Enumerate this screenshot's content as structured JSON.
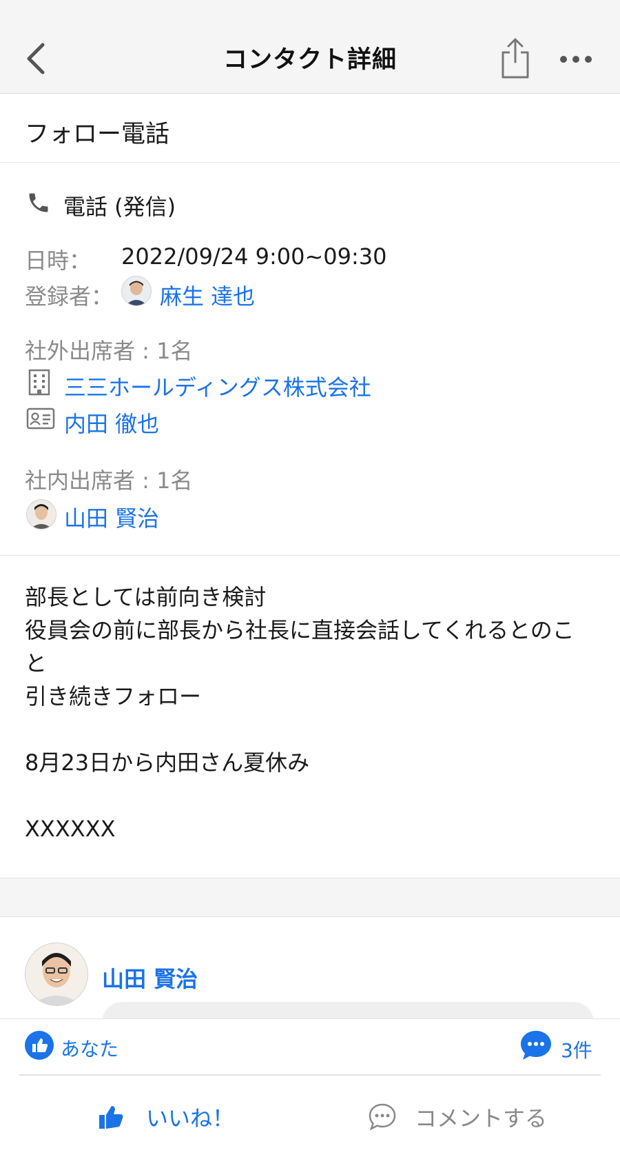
{
  "header": {
    "title": "コンタクト詳細"
  },
  "subject": "フォロー電話",
  "activity": {
    "type_label": "電話 (発信)",
    "datetime_label": "日時：",
    "datetime_value": "2022/09/24 9:00~09:30",
    "registrant_label": "登録者：",
    "registrant_name": "麻生 達也"
  },
  "external": {
    "heading": "社外出席者 : 1名",
    "company": "三三ホールディングス株式会社",
    "person": "内田 徹也"
  },
  "internal": {
    "heading": "社内出席者 : 1名",
    "person": "山田 賢治"
  },
  "notes": {
    "line1": "部長としては前向き検討",
    "line2": "役員会の前に部長から社長に直接会話してくれるとのこ",
    "line3": "と",
    "line4": "引き続きフォロー",
    "line5": "8月23日から内田さん夏休み",
    "line6": "XXXXXX"
  },
  "comment": {
    "author": "山田 賢治"
  },
  "reactions": {
    "liked_by": "あなた",
    "comment_count": "3件",
    "like_button": "いいね！",
    "comment_button": "コメントする"
  },
  "colors": {
    "accent": "#1a73e8",
    "label_gray": "#8a8a8a",
    "header_bg": "#f5f5f5"
  }
}
